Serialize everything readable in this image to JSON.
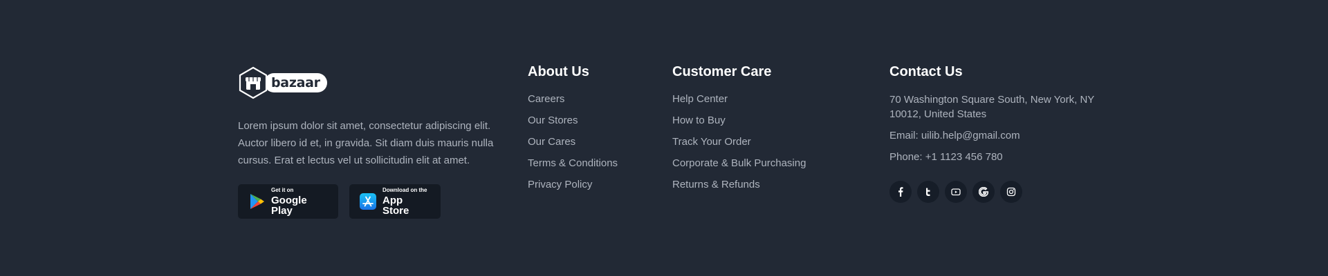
{
  "brand": {
    "logo_text": "bazaar",
    "description": "Lorem ipsum dolor sit amet, consectetur adipiscing elit. Auctor libero id et, in gravida. Sit diam duis mauris nulla cursus. Erat et lectus vel ut sollicitudin elit at amet."
  },
  "stores": {
    "google_play": {
      "small": "Get it on",
      "big": "Google Play"
    },
    "app_store": {
      "small": "Download on the",
      "big": "App Store"
    }
  },
  "about": {
    "title": "About Us",
    "links": [
      "Careers",
      "Our Stores",
      "Our Cares",
      "Terms & Conditions",
      "Privacy Policy"
    ]
  },
  "care": {
    "title": "Customer Care",
    "links": [
      "Help Center",
      "How to Buy",
      "Track Your Order",
      "Corporate & Bulk Purchasing",
      "Returns & Refunds"
    ]
  },
  "contact": {
    "title": "Contact Us",
    "address": "70 Washington Square South, New York, NY 10012, United States",
    "email": "Email: uilib.help@gmail.com",
    "phone": "Phone: +1 1123 456 780"
  },
  "socials": [
    "facebook-icon",
    "twitter-icon",
    "youtube-icon",
    "google-icon",
    "instagram-icon"
  ],
  "colors": {
    "background": "#222935",
    "text": "#AEB4BE",
    "heading": "#FFFFFF",
    "store_button": "#141A23",
    "social_button": "#161D28"
  }
}
